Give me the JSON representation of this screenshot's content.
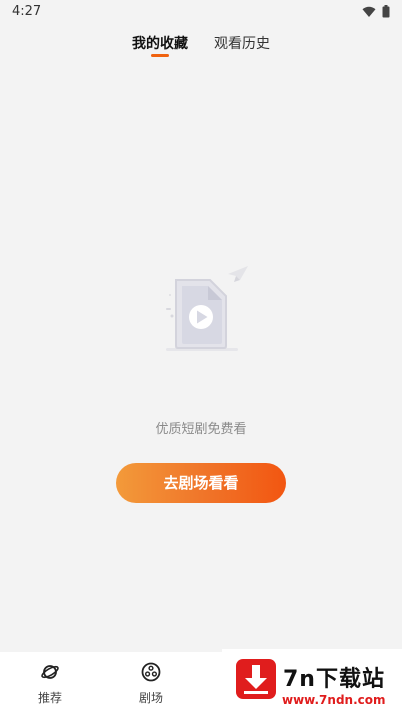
{
  "status_bar": {
    "time": "4:27",
    "icons": [
      "wifi-icon",
      "battery-icon"
    ]
  },
  "tabs": [
    {
      "label": "我的收藏",
      "active": true
    },
    {
      "label": "观看历史",
      "active": false
    }
  ],
  "accent_color": "#f0620f",
  "empty_state": {
    "icon": "video-file-icon",
    "message": "优质短剧免费看",
    "button_label": "去剧场看看"
  },
  "bottom_nav": [
    {
      "label": "推荐",
      "icon": "planet-icon"
    },
    {
      "label": "剧场",
      "icon": "film-reel-icon"
    }
  ],
  "watermark": {
    "title": "7n下载站",
    "url": "www.7ndn.com"
  }
}
